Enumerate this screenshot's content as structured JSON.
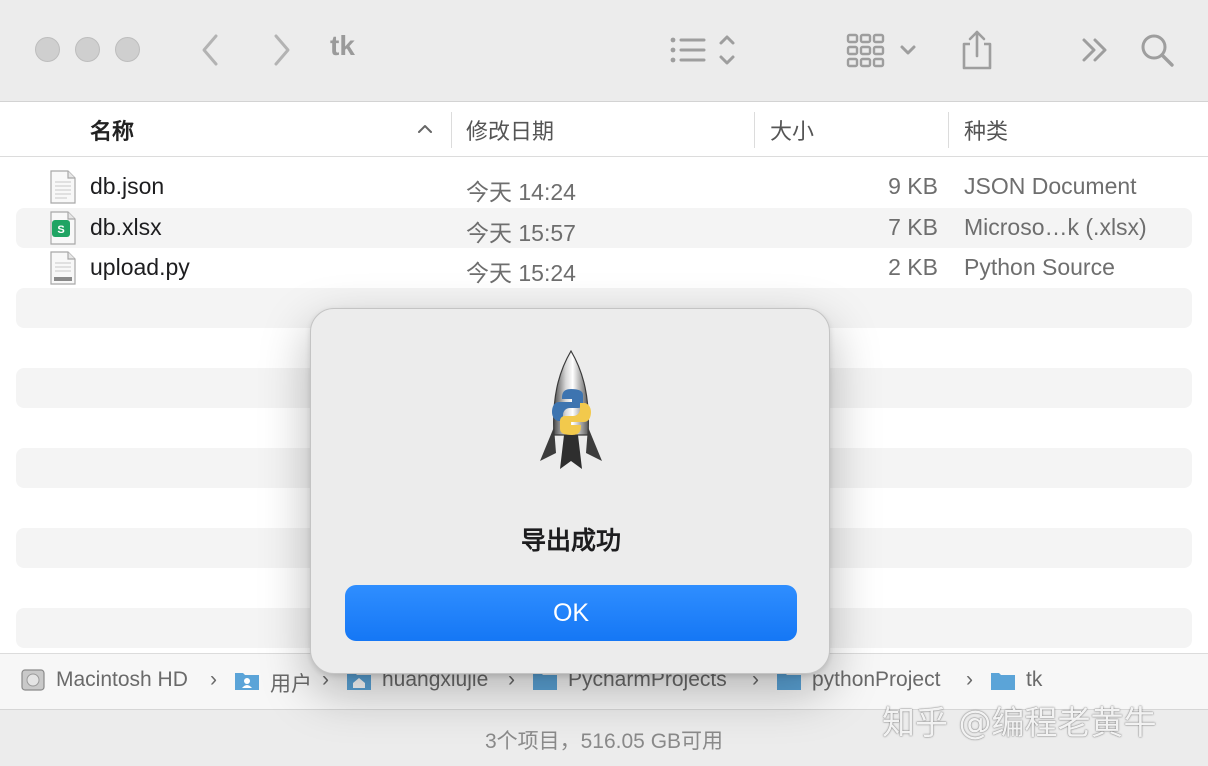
{
  "window": {
    "title": "tk"
  },
  "toolbar": {
    "back_icon": "chevron-left-icon",
    "forward_icon": "chevron-right-icon",
    "list_view_icon": "list-view-icon",
    "group_icon": "grid-group-icon",
    "share_icon": "share-icon",
    "more_icon": "double-chevron-icon",
    "search_icon": "search-icon"
  },
  "columns": {
    "name": "名称",
    "modified": "修改日期",
    "size": "大小",
    "kind": "种类"
  },
  "files": [
    {
      "name": "db.json",
      "modified": "今天 14:24",
      "size": "9 KB",
      "kind": "JSON Document",
      "icon": "document-icon"
    },
    {
      "name": "db.xlsx",
      "modified": "今天 15:57",
      "size": "7 KB",
      "kind": "Microso…k (.xlsx)",
      "icon": "spreadsheet-icon"
    },
    {
      "name": "upload.py",
      "modified": "今天 15:24",
      "size": "2 KB",
      "kind": "Python Source",
      "icon": "python-file-icon"
    }
  ],
  "pathbar": {
    "crumbs": [
      "Macintosh HD",
      "用户",
      "huangxiujie",
      "PycharmProjects",
      "pythonProject",
      "tk"
    ],
    "separator": "›"
  },
  "status": {
    "text": "3个项目，516.05 GB可用"
  },
  "watermark": {
    "text": "知乎 @编程老黄牛"
  },
  "dialog": {
    "message": "导出成功",
    "ok_label": "OK",
    "icon": "python-launcher-rocket-icon"
  },
  "colors": {
    "accent": "#1577f5",
    "toolbar_bg": "#ececec",
    "stripe": "#f4f4f4",
    "folder": "#5ba4d8"
  }
}
